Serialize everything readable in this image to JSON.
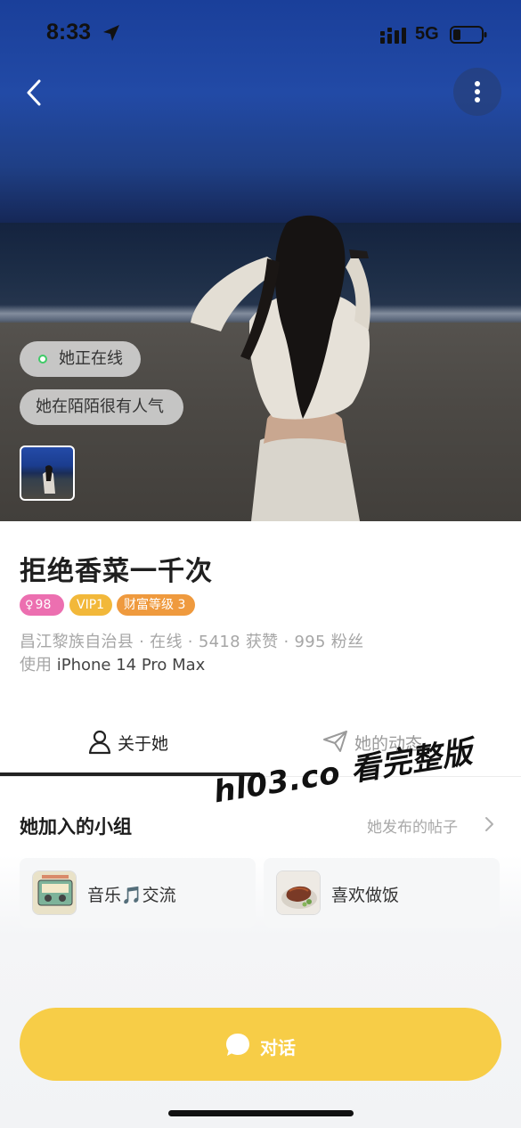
{
  "status_bar": {
    "time": "8:33",
    "network": "5G",
    "icons": [
      "location-arrow-icon",
      "signal-icon",
      "battery-icon"
    ]
  },
  "header": {
    "back_icon": "chevron-left-icon",
    "more_icon": "more-vertical-icon"
  },
  "photo": {
    "online_status": "她正在线",
    "popularity": "她在陌陌很有人气"
  },
  "profile": {
    "name": "拒绝香菜一千次",
    "badges": {
      "gender_age": "98",
      "gender_symbol": "♀",
      "vip": "VIP1",
      "wealth": "财富等级 3"
    },
    "meta": "昌江黎族自治县 · 在线 · 5418 获赞 · 995 粉丝",
    "device_prefix": "使用",
    "device": "iPhone 14 Pro Max"
  },
  "tabs": {
    "about": "关于她",
    "posts": "她的动态"
  },
  "groups": {
    "title": "她加入的小组",
    "link": "她发布的帖子",
    "items": [
      {
        "label": "音乐🎵交流"
      },
      {
        "label": "喜欢做饭"
      }
    ]
  },
  "chat": {
    "label": "对话"
  },
  "watermark": "hl03.co 看完整版",
  "colors": {
    "accent_yellow": "#f7cd47",
    "online_green": "#3ecb66",
    "gender_pink": "#ec6fb0",
    "vip_yellow": "#f2b83a",
    "wealth_orange": "#ef9a3e"
  }
}
